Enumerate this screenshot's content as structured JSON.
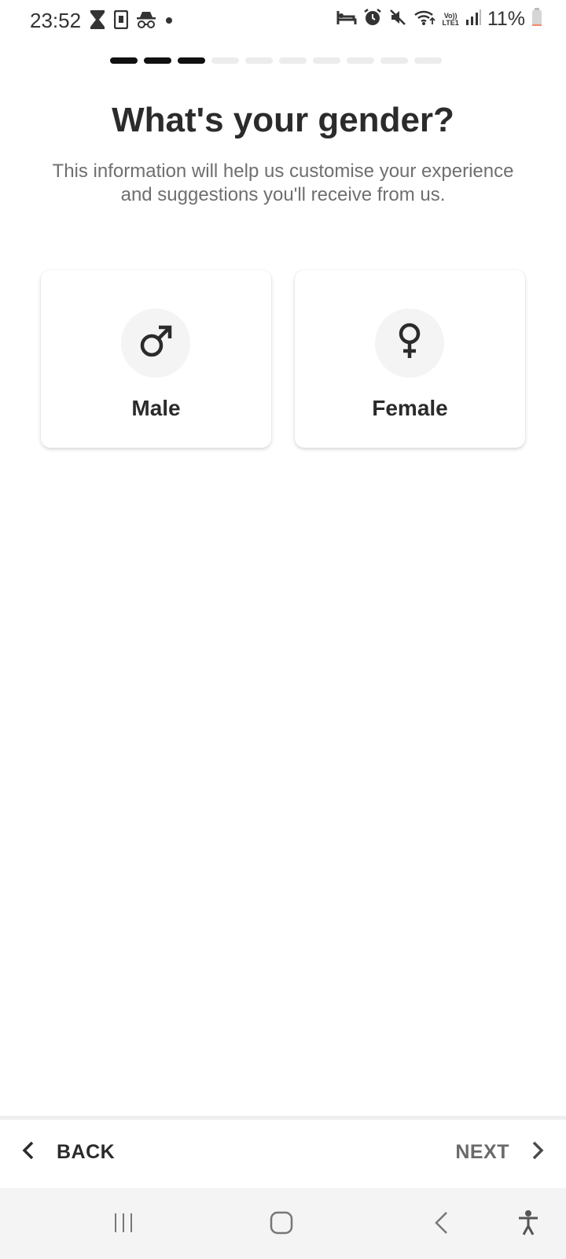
{
  "status_bar": {
    "time": "23:52",
    "left_icons": [
      "hourglass-icon",
      "sim-card-icon",
      "incognito-icon",
      "dot-icon"
    ],
    "right_icons": [
      "bed-icon",
      "alarm-icon",
      "mute-icon",
      "wifi-icon",
      "volte-icon",
      "signal-icon"
    ],
    "volte_top": "Vo))",
    "volte_bottom": "LTE1",
    "battery_percent": "11%",
    "battery_level": 0.11,
    "battery_low_color": "#f28b70"
  },
  "progress": {
    "total_steps": 10,
    "completed_steps": 3,
    "done_color": "#111111",
    "todo_color": "#ececec"
  },
  "page": {
    "title": "What's your gender?",
    "subtitle": "This information will help us customise your experience and suggestions you'll receive from us."
  },
  "options": [
    {
      "label": "Male",
      "icon": "male-symbol-icon"
    },
    {
      "label": "Female",
      "icon": "female-symbol-icon"
    }
  ],
  "actions": {
    "back_label": "BACK",
    "next_label": "NEXT"
  },
  "system_nav": [
    "recent-apps-icon",
    "home-icon",
    "back-icon",
    "accessibility-icon"
  ]
}
